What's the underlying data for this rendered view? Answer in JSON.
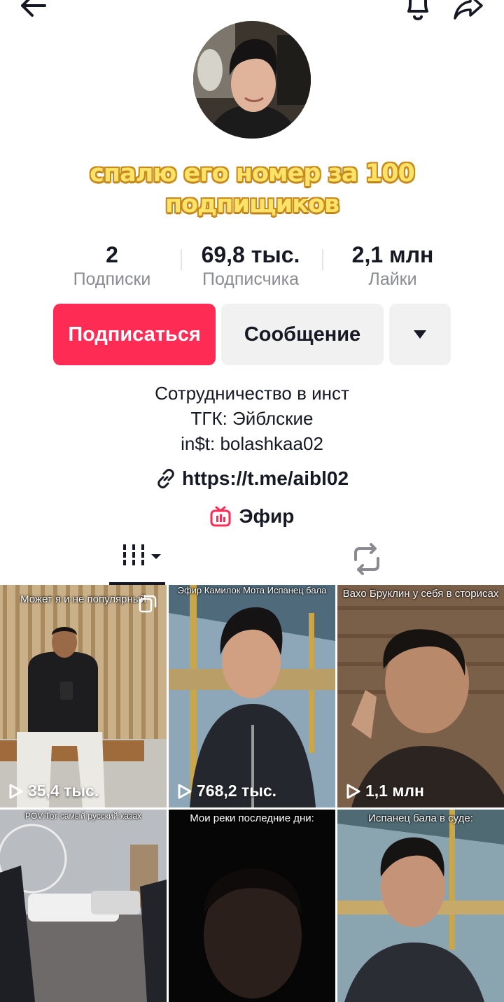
{
  "profile": {
    "nickname_line1": "спалю его номер за 100",
    "nickname_line2": "подпищиков"
  },
  "stats": [
    {
      "value": "2",
      "label": "Подписки"
    },
    {
      "value": "69,8 тыс.",
      "label": "Подписчика"
    },
    {
      "value": "2,1 млн",
      "label": "Лайки"
    }
  ],
  "actions": {
    "follow_label": "Подписаться",
    "message_label": "Сообщение"
  },
  "bio": {
    "line1": "Сотрудничество в инст",
    "line2": "ТГК: Эйблские",
    "line3": "in$t: bolashkaa02"
  },
  "link": {
    "text": "https://t.me/aibl02"
  },
  "live": {
    "label": "Эфир"
  },
  "colors": {
    "accent": "#fe2c55",
    "text": "#161823",
    "muted": "#8a8b91",
    "button_bg": "#f1f1f2"
  },
  "icons": [
    "back-arrow-icon",
    "bell-icon",
    "share-icon",
    "caret-down-icon",
    "link-icon",
    "live-tv-icon",
    "videos-grid-icon",
    "repost-icon",
    "play-icon"
  ],
  "videos": [
    {
      "caption": "Может я и не популярный",
      "views": "35,4 тыс."
    },
    {
      "caption": "Эфир Камилок Мота Испанец бала",
      "views": "768,2 тыс."
    },
    {
      "caption": "Вахо Бруклин у себя в сторисах",
      "views": "1,1 млн"
    },
    {
      "caption": "POV:Тот самый русский казах",
      "views": ""
    },
    {
      "caption": "Мои реки последние дни:",
      "views": ""
    },
    {
      "caption": "Испанец бала в суде:",
      "views": ""
    }
  ]
}
